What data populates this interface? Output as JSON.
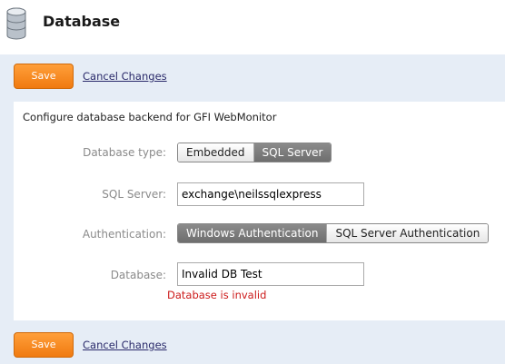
{
  "header": {
    "title": "Database",
    "icon": "database-icon"
  },
  "toolbar": {
    "save_label": "Save",
    "cancel_label": "Cancel Changes"
  },
  "form": {
    "intro": "Configure database backend for GFI WebMonitor",
    "database_type": {
      "label": "Database type:",
      "options": [
        "Embedded",
        "SQL Server"
      ],
      "selected": "SQL Server"
    },
    "sql_server": {
      "label": "SQL Server:",
      "value": "exchange\\neilssqlexpress"
    },
    "authentication": {
      "label": "Authentication:",
      "options": [
        "Windows Authentication",
        "SQL Server Authentication"
      ],
      "selected": "Windows Authentication"
    },
    "database": {
      "label": "Database:",
      "value": "Invalid DB Test",
      "error": "Database is invalid"
    }
  },
  "colors": {
    "accent": "#f58a1f",
    "panel_bg": "#e6edf6",
    "error": "#cc1a1a",
    "segment_active": "#7a7a7a"
  }
}
